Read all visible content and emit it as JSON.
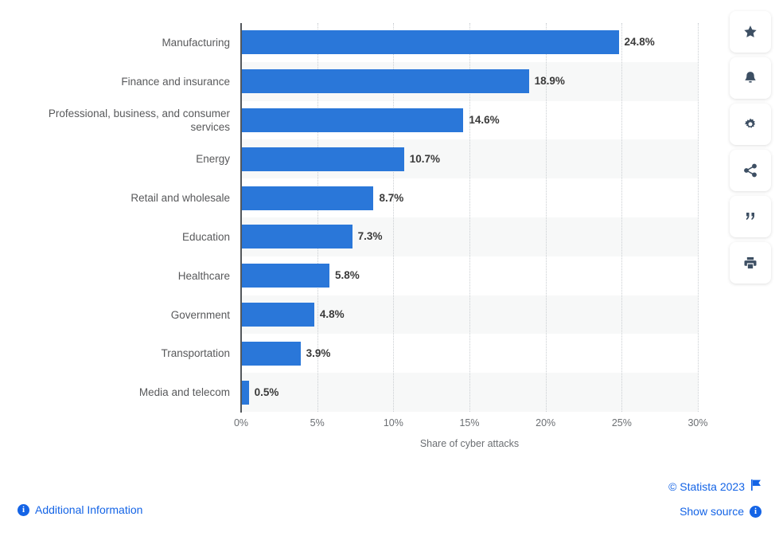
{
  "chart_data": {
    "type": "bar",
    "orientation": "horizontal",
    "title": "",
    "xlabel": "Share of cyber attacks",
    "ylabel": "",
    "xlim": [
      0,
      30
    ],
    "xtick_labels": [
      "0%",
      "5%",
      "10%",
      "15%",
      "20%",
      "25%",
      "30%"
    ],
    "xticks": [
      0,
      5,
      10,
      15,
      20,
      25,
      30
    ],
    "grid": "vertical-dotted",
    "legend": "none",
    "bar_color": "#2a77d9",
    "categories": [
      "Manufacturing",
      "Finance and insurance",
      "Professional, business, and consumer services",
      "Energy",
      "Retail and wholesale",
      "Education",
      "Healthcare",
      "Government",
      "Transportation",
      "Media and telecom"
    ],
    "values": [
      24.8,
      18.9,
      14.6,
      10.7,
      8.7,
      7.3,
      5.8,
      4.8,
      3.9,
      0.5
    ],
    "value_labels": [
      "24.8%",
      "18.9%",
      "14.6%",
      "10.7%",
      "8.7%",
      "7.3%",
      "5.8%",
      "4.8%",
      "3.9%",
      "0.5%"
    ]
  },
  "toolbar": {
    "items": [
      {
        "icon": "star-icon",
        "label": "Favorite"
      },
      {
        "icon": "bell-icon",
        "label": "Notification"
      },
      {
        "icon": "gear-icon",
        "label": "Settings"
      },
      {
        "icon": "share-icon",
        "label": "Share"
      },
      {
        "icon": "quote-icon",
        "label": "Citation"
      },
      {
        "icon": "print-icon",
        "label": "Print"
      }
    ]
  },
  "footer": {
    "additional_information": "Additional Information",
    "copyright": "© Statista 2023",
    "show_source": "Show source",
    "info_glyph": "i",
    "link_color": "#1464e6"
  }
}
